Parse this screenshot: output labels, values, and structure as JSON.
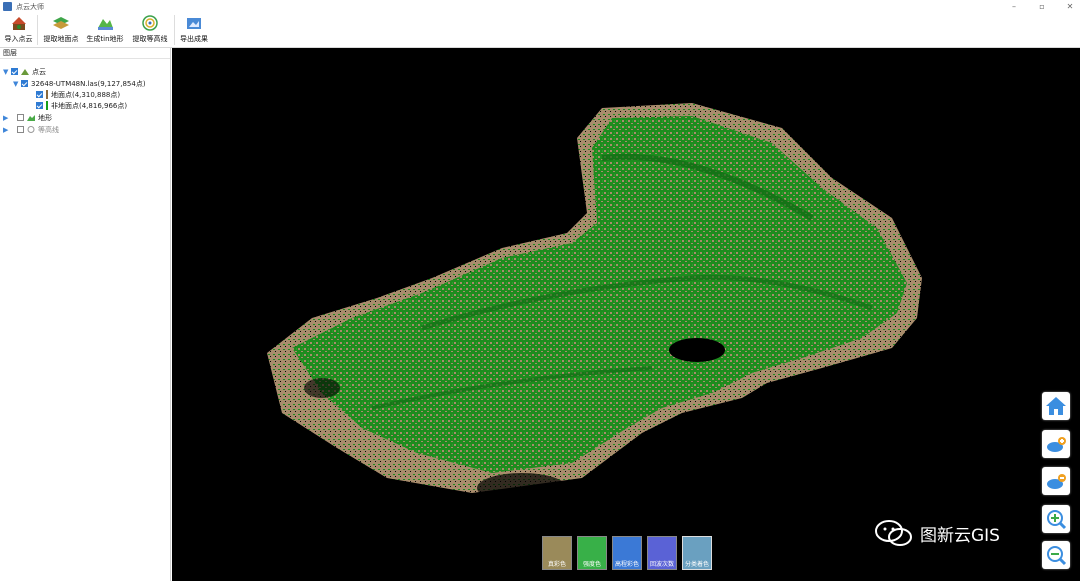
{
  "window": {
    "title": "点云大师"
  },
  "toolbar": {
    "items": [
      {
        "label": "导入点云",
        "icon": "import-pointcloud-icon"
      },
      {
        "label": "提取地面点",
        "icon": "extract-ground-icon"
      },
      {
        "label": "生成tin地形",
        "icon": "generate-tin-icon"
      },
      {
        "label": "提取等高线",
        "icon": "extract-contour-icon"
      },
      {
        "label": "导出成果",
        "icon": "export-result-icon"
      }
    ]
  },
  "layers": {
    "title": "图层",
    "items": [
      {
        "label": "点云",
        "checked": true,
        "expanded": true
      },
      {
        "label": "32648-UTM48N.las(9,127,854点)",
        "checked": true,
        "expanded": true
      },
      {
        "label": "地面点(4,310,888点)",
        "checked": true,
        "swatch": "#8b6a3e"
      },
      {
        "label": "非地面点(4,816,966点)",
        "checked": true,
        "swatch": "#18a018"
      },
      {
        "label": "地形",
        "checked": false,
        "expanded": false
      },
      {
        "label": "等高线",
        "checked": false,
        "expanded": false
      }
    ]
  },
  "colors": {
    "ground": "#a88c6c",
    "vegetation": "#1e8c1e",
    "background": "#000000"
  },
  "render_buttons": [
    {
      "label": "真彩色",
      "color": "#9a8a5a"
    },
    {
      "label": "强度色",
      "color": "#38b048"
    },
    {
      "label": "高程彩色",
      "color": "#3b79d6"
    },
    {
      "label": "回波次数",
      "color": "#5a62d6"
    },
    {
      "label": "分类着色",
      "color": "#6aa0c0"
    }
  ],
  "side_buttons": [
    "home-icon",
    "cloud-add-icon",
    "cloud-remove-icon",
    "zoom-in-icon",
    "zoom-out-icon"
  ],
  "watermark": {
    "text": "图新云GIS"
  }
}
